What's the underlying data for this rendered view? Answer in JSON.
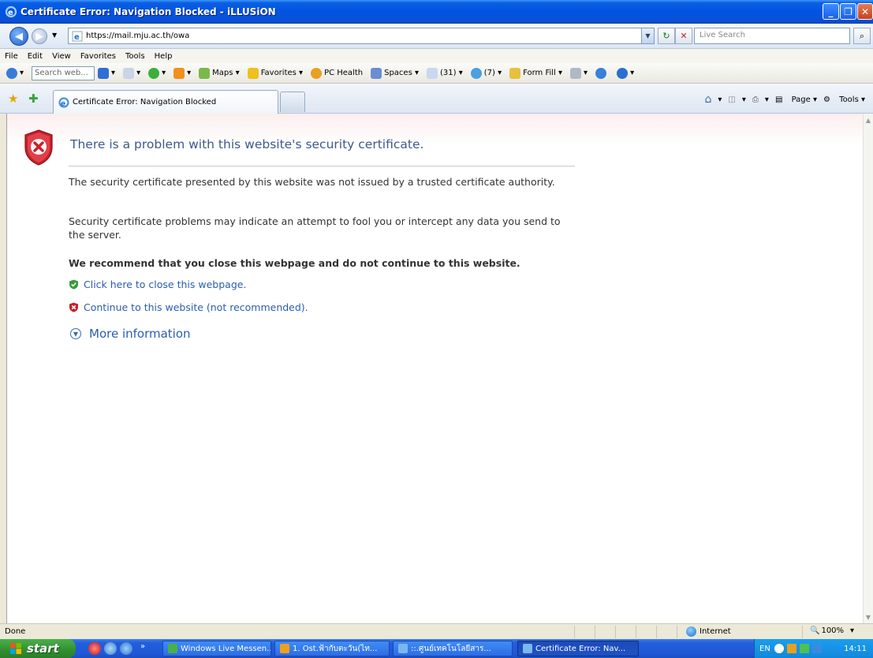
{
  "window": {
    "title": "Certificate Error: Navigation Blocked - iLLUSiON",
    "min_label": "_",
    "max_label": "❐",
    "close_label": "✕"
  },
  "address_bar": {
    "url": "https://mail.mju.ac.th/owa",
    "live_search_placeholder": "Live Search"
  },
  "menu": [
    "File",
    "Edit",
    "View",
    "Favorites",
    "Tools",
    "Help"
  ],
  "toolbar": {
    "search_placeholder": "Search web...",
    "maps": "Maps",
    "favorites": "Favorites",
    "pc_health": "PC Health",
    "spaces": "Spaces",
    "mail_count": "(31)",
    "contacts_count": "(7)",
    "form_fill": "Form Fill"
  },
  "tabs": {
    "active_label": "Certificate Error: Navigation Blocked",
    "page_menu": "Page",
    "tools_menu": "Tools"
  },
  "content": {
    "heading": "There is a problem with this website's security certificate.",
    "para1": "The security certificate presented by this website was not issued by a trusted certificate authority.",
    "para2": "Security certificate problems may indicate an attempt to fool you or intercept any data you send to the server.",
    "recommend": "We recommend that you close this webpage and do not continue to this website.",
    "close_link": "Click here to close this webpage.",
    "continue_link": "Continue to this website (not recommended).",
    "more_info": "More information"
  },
  "status": {
    "text": "Done",
    "zone": "Internet",
    "zoom": "100%"
  },
  "taskbar": {
    "start": "start",
    "tasks": [
      "Windows Live Messen...",
      "1. Ost.ฟ้ากับตะวัน(ไท...",
      "::.ศูนย์เทคโนโลยีสาร...",
      "Certificate Error: Nav..."
    ],
    "lang": "EN",
    "clock": "14:11"
  },
  "colors": {
    "link": "#2a5db0",
    "heading": "#3c5a8a",
    "error_red": "#c8202a",
    "safe_green": "#3a9a3a"
  }
}
